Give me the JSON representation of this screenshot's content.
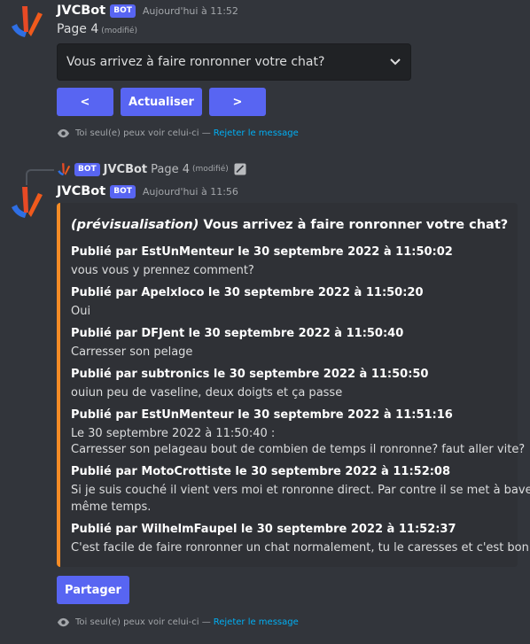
{
  "message1": {
    "author": "JVCBot",
    "badge": "BOT",
    "timestamp": "Aujourd'hui à 11:52",
    "content": "Page 4",
    "edited": "(modifié)",
    "select_value": "Vous arrivez à faire ronronner votre chat?",
    "buttons": {
      "prev": "<",
      "refresh": "Actualiser",
      "next": ">"
    },
    "ephemeral_text": "Toi seul(e) peux voir celui-ci —",
    "ephemeral_link": "Rejeter le message"
  },
  "reply": {
    "badge": "BOT",
    "author": "JVCBot",
    "text": "Page 4",
    "edited": "(modifié)"
  },
  "message2": {
    "author": "JVCBot",
    "badge": "BOT",
    "timestamp": "Aujourd'hui à 11:56",
    "embed": {
      "accent_color": "#f48c26",
      "title_prefix": "(prévisualisation)",
      "title_rest": " Vous arrivez à faire ronronner votre chat?",
      "fields": [
        {
          "name": "Publié par EstUnMenteur le 30 septembre 2022 à 11:50:02",
          "lines": [
            "vous vous y prennez comment?"
          ]
        },
        {
          "name": "Publié par Apelxloco le 30 septembre 2022 à 11:50:20",
          "lines": [
            "Oui"
          ]
        },
        {
          "name": "Publié par DFJent le 30 septembre 2022 à 11:50:40",
          "lines": [
            "Carresser son pelage"
          ]
        },
        {
          "name": "Publié par subtronics le 30 septembre 2022 à 11:50:50",
          "lines": [
            "ouiun peu de vaseline, deux doigts et ça passe"
          ]
        },
        {
          "name": "Publié par EstUnMenteur le 30 septembre 2022 à 11:51:16",
          "lines": [
            "Le 30 septembre 2022 à 11:50:40 :",
            "Carresser son pelageau bout de combien de temps il ronronne? faut aller vite?"
          ]
        },
        {
          "name": "Publié par MotoCrottiste le 30 septembre 2022 à 11:52:08",
          "lines": [
            "Si je suis couché il vient vers moi et ronronne direct. Par contre il se met à baver en",
            "même temps."
          ]
        },
        {
          "name": "Publié par WilhelmFaupel le 30 septembre 2022 à 11:52:37",
          "lines": [
            "C'est facile de faire ronronner un chat normalement, tu le caresses et c'est bon"
          ]
        }
      ]
    },
    "share_button": "Partager",
    "ephemeral_text": "Toi seul(e) peux voir celui-ci —",
    "ephemeral_link": "Rejeter le message"
  }
}
